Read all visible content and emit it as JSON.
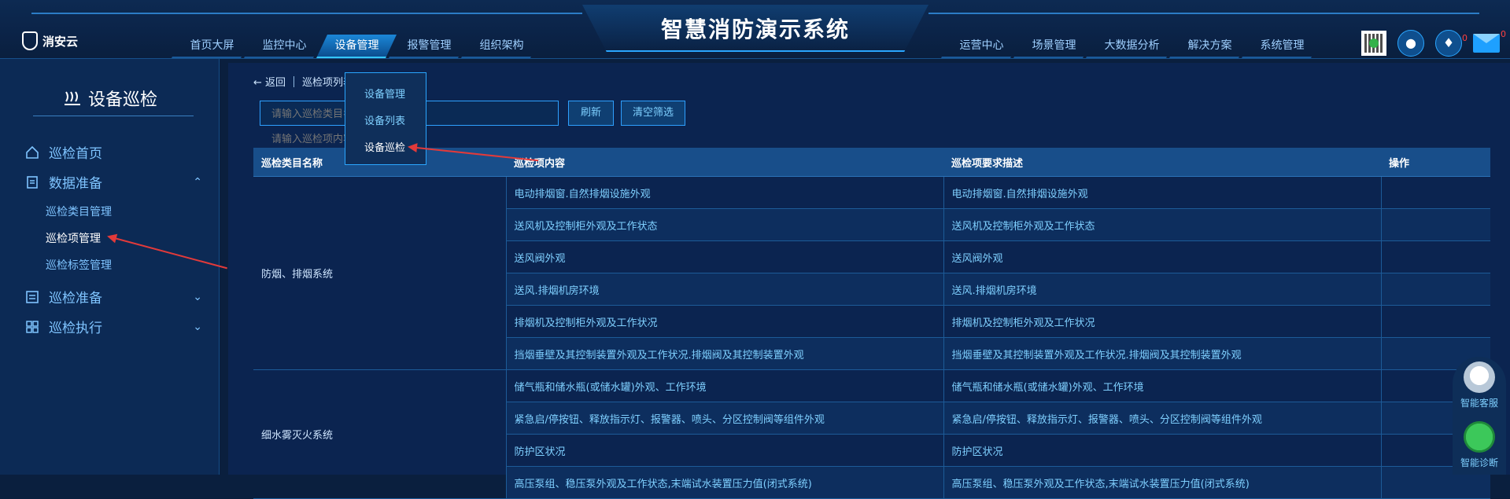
{
  "header": {
    "logo_text": "消安云",
    "system_title": "智慧消防演示系统",
    "nav_left": [
      "首页大屏",
      "监控中心",
      "设备管理",
      "报警管理",
      "组织架构"
    ],
    "nav_right": [
      "运营中心",
      "场景管理",
      "大数据分析",
      "解决方案",
      "系统管理"
    ],
    "active_nav": "设备管理",
    "alarm_badge": "0",
    "mail_badge": "0"
  },
  "sidebar": {
    "title": "设备巡检",
    "items": [
      {
        "label": "巡检首页"
      },
      {
        "label": "数据准备",
        "expanded": true,
        "children": [
          "巡检类目管理",
          "巡检项管理",
          "巡检标签管理"
        ]
      },
      {
        "label": "巡检准备"
      },
      {
        "label": "巡检执行"
      }
    ],
    "active_child": "巡检项管理"
  },
  "dropdown": {
    "items": [
      "设备管理",
      "设备列表",
      "设备巡检"
    ],
    "active": "设备巡检"
  },
  "breadcrumb": {
    "back": "返回",
    "current": "巡检项列表"
  },
  "search": {
    "category_placeholder": "请输入巡检类目名称",
    "content_placeholder": "请输入巡检项内容",
    "refresh_label": "刷新",
    "clear_label": "清空筛选"
  },
  "table": {
    "headers": [
      "巡检类目名称",
      "巡检项内容",
      "巡检项要求描述",
      "操作"
    ],
    "groups": [
      {
        "category": "防烟、排烟系统",
        "rows": [
          [
            "电动排烟窗.自然排烟设施外观",
            "电动排烟窗.自然排烟设施外观"
          ],
          [
            "送风机及控制柜外观及工作状态",
            "送风机及控制柜外观及工作状态"
          ],
          [
            "送风阀外观",
            "送风阀外观"
          ],
          [
            "送风.排烟机房环境",
            "送风.排烟机房环境"
          ],
          [
            "排烟机及控制柜外观及工作状况",
            "排烟机及控制柜外观及工作状况"
          ],
          [
            "挡烟垂壁及其控制装置外观及工作状况.排烟阀及其控制装置外观",
            "挡烟垂壁及其控制装置外观及工作状况.排烟阀及其控制装置外观"
          ]
        ]
      },
      {
        "category": "细水雾灭火系统",
        "rows": [
          [
            "储气瓶和储水瓶(或储水罐)外观、工作环境",
            "储气瓶和储水瓶(或储水罐)外观、工作环境"
          ],
          [
            "紧急启/停按钮、释放指示灯、报警器、喷头、分区控制阀等组件外观",
            "紧急启/停按钮、释放指示灯、报警器、喷头、分区控制阀等组件外观"
          ],
          [
            "防护区状况",
            "防护区状况"
          ],
          [
            "高压泵组、稳压泵外观及工作状态,末端试水装置压力值(闭式系统)",
            "高压泵组、稳压泵外观及工作状态,末端试水装置压力值(闭式系统)"
          ]
        ]
      }
    ]
  },
  "float_service": {
    "service_label": "智能客服",
    "diagnosis_label": "智能诊断"
  },
  "colors": {
    "background": "#0a1f3e",
    "accent": "#2aa6ff",
    "link_text": "#7fd0ff",
    "annotation_arrow": "#e23a3a"
  }
}
